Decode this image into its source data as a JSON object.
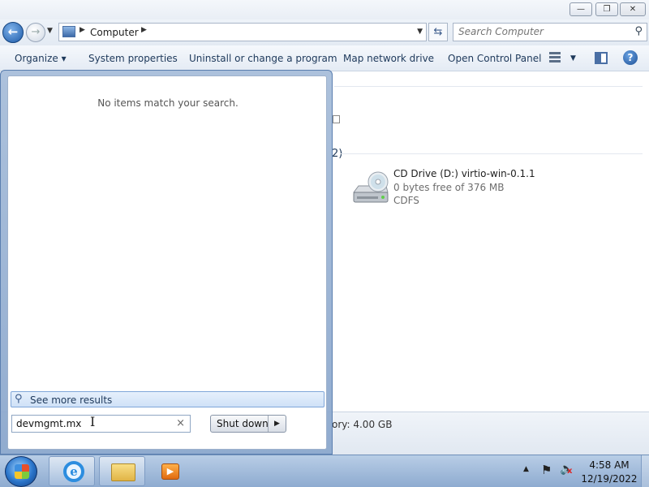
{
  "window": {
    "minimize_glyph": "—",
    "restore_glyph": "❐",
    "close_glyph": "✕"
  },
  "nav": {
    "back_glyph": "←",
    "forward_glyph": "→",
    "dropdown_glyph": "▼",
    "address": "Computer",
    "crumb_arrow": "▶",
    "refresh_glyph": "⇆",
    "search_placeholder": "Search Computer",
    "search_glyph": "⚲"
  },
  "toolbar": {
    "organize": "Organize ▾",
    "system_properties": "System properties",
    "uninstall": "Uninstall or change a program",
    "map_drive": "Map network drive",
    "control_panel": "Open Control Panel",
    "views_arrow": "▼",
    "help": "?"
  },
  "content": {
    "group_count_fragment": "2)",
    "drive": {
      "name": "CD Drive (D:) virtio-win-0.1.1",
      "free": "0 bytes free of 376 MB",
      "filesystem": "CDFS"
    },
    "details": {
      "memory": "ory: 4.00 GB"
    }
  },
  "start_menu": {
    "no_items": "No items match your search.",
    "see_more": "See more results",
    "search_value": "devmgmt.mx",
    "clear_glyph": "×",
    "shutdown_label": "Shut down",
    "shutdown_arrow": "▶"
  },
  "taskbar": {
    "ie_glyph": "e",
    "wmp_glyph": "▶",
    "tray_up": "▲",
    "flag_glyph": "⚑",
    "volume_glyph": "🔈",
    "mute_glyph": "x",
    "time": "4:58 AM",
    "date": "12/19/2022"
  }
}
